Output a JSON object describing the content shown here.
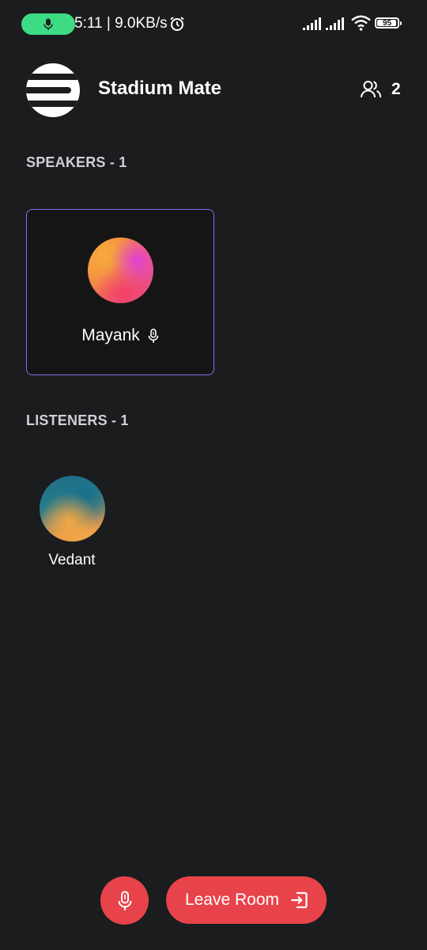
{
  "status_bar": {
    "time_speed": "5:11 | 9.0KB/s",
    "battery_level": "95",
    "icons": [
      "mic-icon",
      "alarm-icon",
      "signal-icon",
      "signal-icon",
      "wifi-icon",
      "battery-icon"
    ],
    "mic_pill_color": "#3ddc84"
  },
  "header": {
    "room_title": "Stadium Mate",
    "participant_count": "2",
    "icons": [
      "room-logo",
      "users-icon"
    ]
  },
  "speakers": {
    "label": "SPEAKERS - 1",
    "items": [
      {
        "name": "Mayank",
        "icon": "mic-icon"
      }
    ],
    "card_border_color": "#8f6bf2"
  },
  "listeners": {
    "label": "LISTENERS - 1",
    "items": [
      {
        "name": "Vedant"
      }
    ]
  },
  "controls": {
    "mic_icon": "mic-icon",
    "leave_label": "Leave Room",
    "leave_icon": "exit-icon",
    "accent_color": "#e8434a"
  },
  "colors": {
    "background": "#1b1c1e",
    "section_label": "#cfd0d4"
  }
}
